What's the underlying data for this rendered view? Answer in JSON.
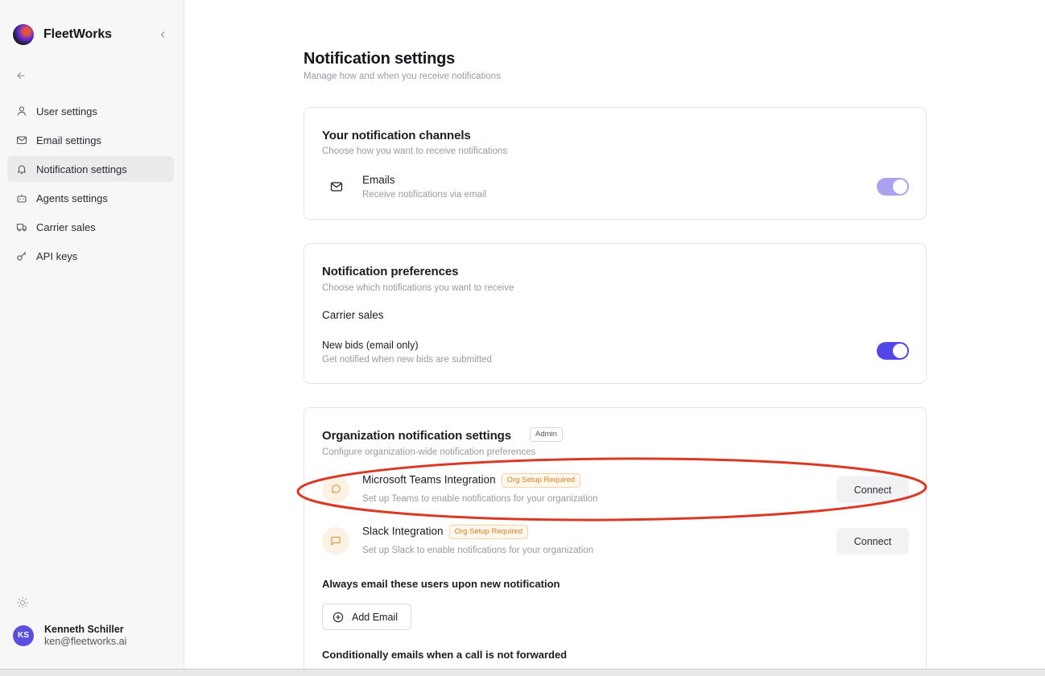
{
  "app": {
    "name": "FleetWorks"
  },
  "sidebar": {
    "items": [
      {
        "label": "User settings",
        "icon": "user-icon"
      },
      {
        "label": "Email settings",
        "icon": "mail-icon"
      },
      {
        "label": "Notification settings",
        "icon": "bell-icon",
        "active": true
      },
      {
        "label": "Agents settings",
        "icon": "bot-icon"
      },
      {
        "label": "Carrier sales",
        "icon": "truck-icon"
      },
      {
        "label": "API keys",
        "icon": "key-icon"
      }
    ]
  },
  "user": {
    "initials": "KS",
    "name": "Kenneth Schiller",
    "email": "ken@fleetworks.ai"
  },
  "page": {
    "title": "Notification settings",
    "subtitle": "Manage how and when you receive notifications"
  },
  "channels": {
    "title": "Your notification channels",
    "subtitle": "Choose how you want to receive notifications",
    "emails": {
      "label": "Emails",
      "description": "Receive notifications via email",
      "enabled": true
    }
  },
  "preferences": {
    "title": "Notification preferences",
    "subtitle": "Choose which notifications you want to receive",
    "group": "Carrier sales",
    "new_bids": {
      "label": "New bids (email only)",
      "description": "Get notified when new bids are submitted",
      "enabled": true
    }
  },
  "organization": {
    "title": "Organization notification settings",
    "badge": "Admin",
    "subtitle": "Configure organization-wide notification preferences",
    "teams": {
      "label": "Microsoft Teams Integration",
      "badge": "Org Setup Required",
      "description": "Set up Teams to enable notifications for your organization",
      "button": "Connect"
    },
    "slack": {
      "label": "Slack Integration",
      "badge": "Org Setup Required",
      "description": "Set up Slack to enable notifications for your organization",
      "button": "Connect"
    },
    "always_email": {
      "label": "Always email these users upon new notification",
      "button": "Add Email"
    },
    "conditional": {
      "label": "Conditionally emails when a call is not forwarded"
    }
  },
  "colors": {
    "toggle_on": "#5246e6",
    "toggle_on_muted": "#a9a3ef",
    "annotation": "#d93a26",
    "badge_orange": "#d98324"
  }
}
